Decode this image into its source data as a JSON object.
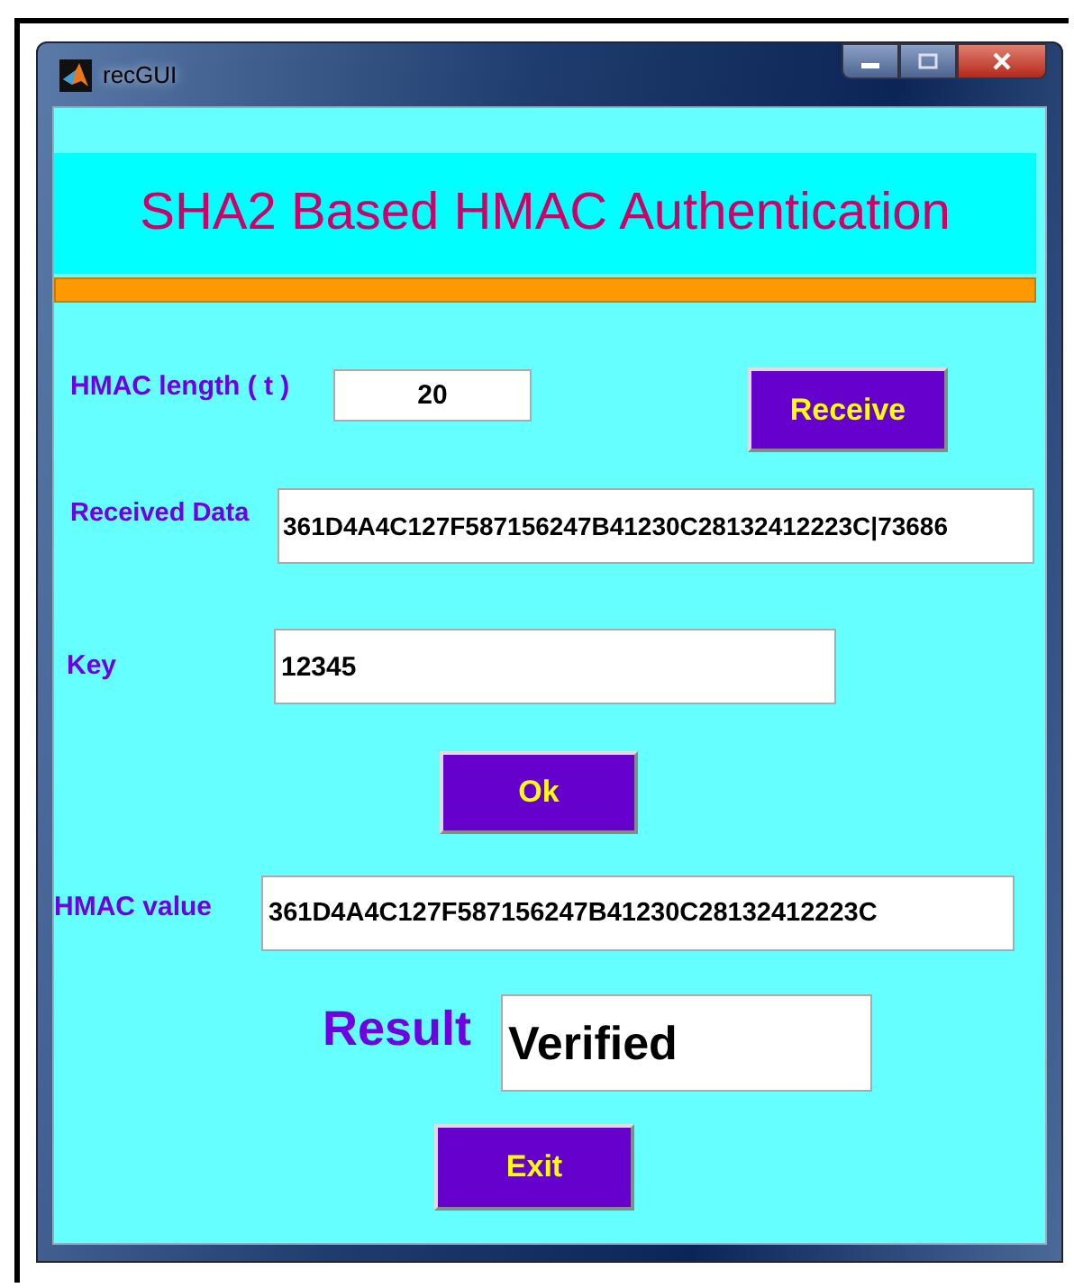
{
  "window": {
    "title": "recGUI"
  },
  "heading": "SHA2 Based HMAC Authentication",
  "hmac_length": {
    "label": "HMAC length ( t )",
    "value": "20"
  },
  "receive_button": "Receive",
  "received_data": {
    "label": "Received Data",
    "value": "361D4A4C127F587156247B41230C28132412223C|73686"
  },
  "key": {
    "label": "Key",
    "value": "12345"
  },
  "ok_button": "Ok",
  "hmac_value": {
    "label": "HMAC value",
    "value": "361D4A4C127F587156247B41230C28132412223C"
  },
  "result": {
    "label": "Result",
    "value": "Verified"
  },
  "exit_button": "Exit"
}
